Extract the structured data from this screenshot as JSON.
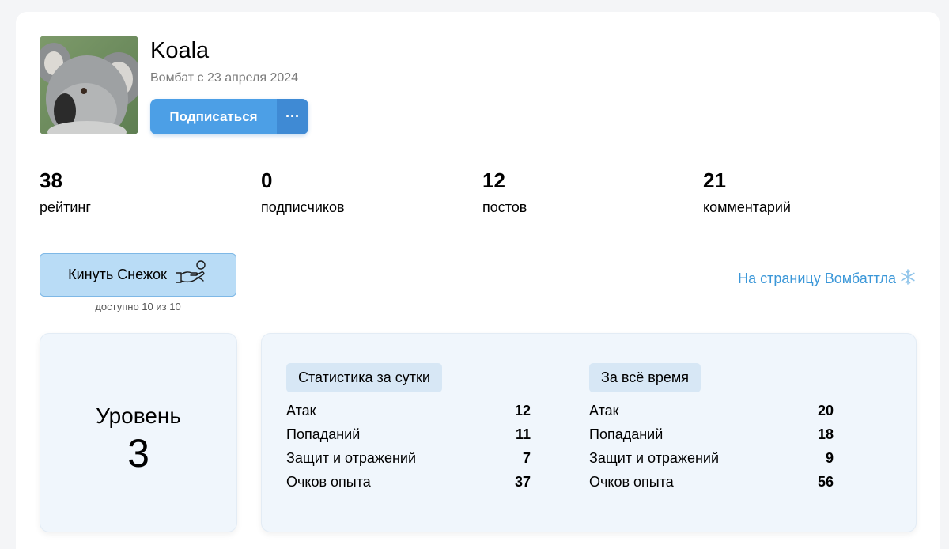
{
  "profile": {
    "name": "Koala",
    "since": "Вомбат с 23 апреля 2024",
    "subscribe_label": "Подписаться",
    "more_label": "···"
  },
  "stats": [
    {
      "value": "38",
      "label": "рейтинг"
    },
    {
      "value": "0",
      "label": "подписчиков"
    },
    {
      "value": "12",
      "label": "постов"
    },
    {
      "value": "21",
      "label": "комментарий"
    }
  ],
  "snowball": {
    "button_label": "Кинуть Снежок",
    "availability": "доступно 10 из 10"
  },
  "battle_link": {
    "label": "На страницу Вомбаттла"
  },
  "level": {
    "label": "Уровень",
    "value": "3"
  },
  "daily": {
    "title": "Статистика за сутки",
    "rows": [
      {
        "label": "Атак",
        "value": "12"
      },
      {
        "label": "Попаданий",
        "value": "11"
      },
      {
        "label": "Защит и отражений",
        "value": "7"
      },
      {
        "label": "Очков опыта",
        "value": "37"
      }
    ]
  },
  "alltime": {
    "title": "За всё время",
    "rows": [
      {
        "label": "Атак",
        "value": "20"
      },
      {
        "label": "Попаданий",
        "value": "18"
      },
      {
        "label": "Защит и отражений",
        "value": "9"
      },
      {
        "label": "Очков опыта",
        "value": "56"
      }
    ]
  },
  "colors": {
    "accent": "#4c9fe6",
    "link": "#3b97d8",
    "snow_button_bg": "#b9dcf6",
    "panel_bg": "#f0f6fc"
  },
  "icons": {
    "snowball_button": "hand-snowball-icon",
    "battle_link": "snowflake-icon",
    "avatar": "koala-avatar-image"
  }
}
